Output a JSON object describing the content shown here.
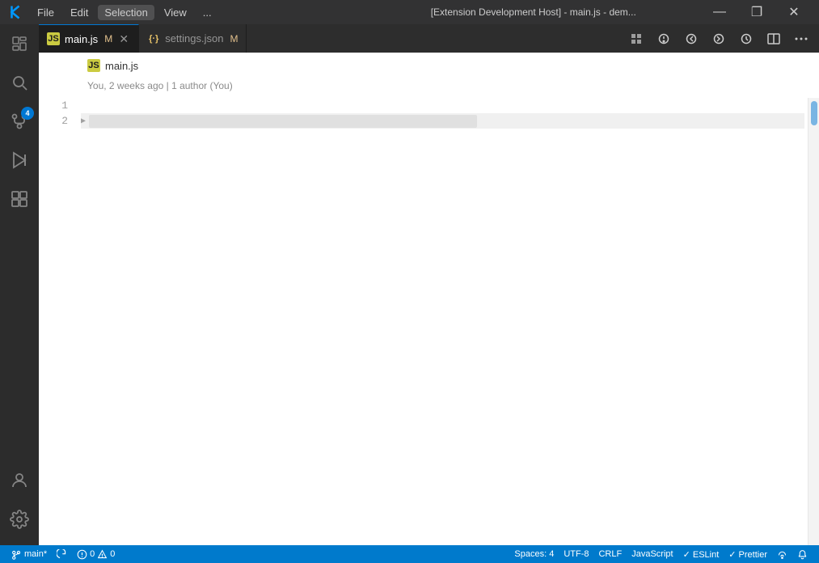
{
  "titlebar": {
    "menu_items": [
      "File",
      "Edit",
      "Selection",
      "View",
      "..."
    ],
    "title": "[Extension Development Host] - main.js - dem...",
    "btn_minimize": "—",
    "btn_maximize": "❐",
    "btn_close": "✕"
  },
  "tabs": [
    {
      "id": "main-js",
      "label": "main.js",
      "modified": "M",
      "icon": "js",
      "active": true
    },
    {
      "id": "settings-json",
      "label": "settings.json",
      "modified": "M",
      "icon": "json",
      "active": false
    }
  ],
  "editor": {
    "file_icon": "JS",
    "filename": "main.js",
    "meta": "You, 2 weeks ago | 1 author (You)",
    "lines": [
      {
        "num": 1,
        "content": ""
      },
      {
        "num": 2,
        "content": ""
      }
    ]
  },
  "statusbar": {
    "branch": "main*",
    "sync_icon": "sync",
    "errors": "0",
    "warnings": "0",
    "spaces": "Spaces: 4",
    "encoding": "UTF-8",
    "eol": "CRLF",
    "language": "JavaScript",
    "eslint": "✓ ESLint",
    "prettier": "✓ Prettier",
    "bell_icon": "bell",
    "broadcast_icon": "broadcast"
  },
  "activity": {
    "items": [
      {
        "id": "explorer",
        "icon": "files",
        "active": false
      },
      {
        "id": "search",
        "icon": "search",
        "active": false
      },
      {
        "id": "source-control",
        "icon": "source-control",
        "badge": "4",
        "active": false
      },
      {
        "id": "run",
        "icon": "run",
        "active": false
      },
      {
        "id": "extensions",
        "icon": "extensions",
        "active": false
      }
    ],
    "bottom_items": [
      {
        "id": "accounts",
        "icon": "person"
      },
      {
        "id": "settings",
        "icon": "gear"
      }
    ]
  }
}
